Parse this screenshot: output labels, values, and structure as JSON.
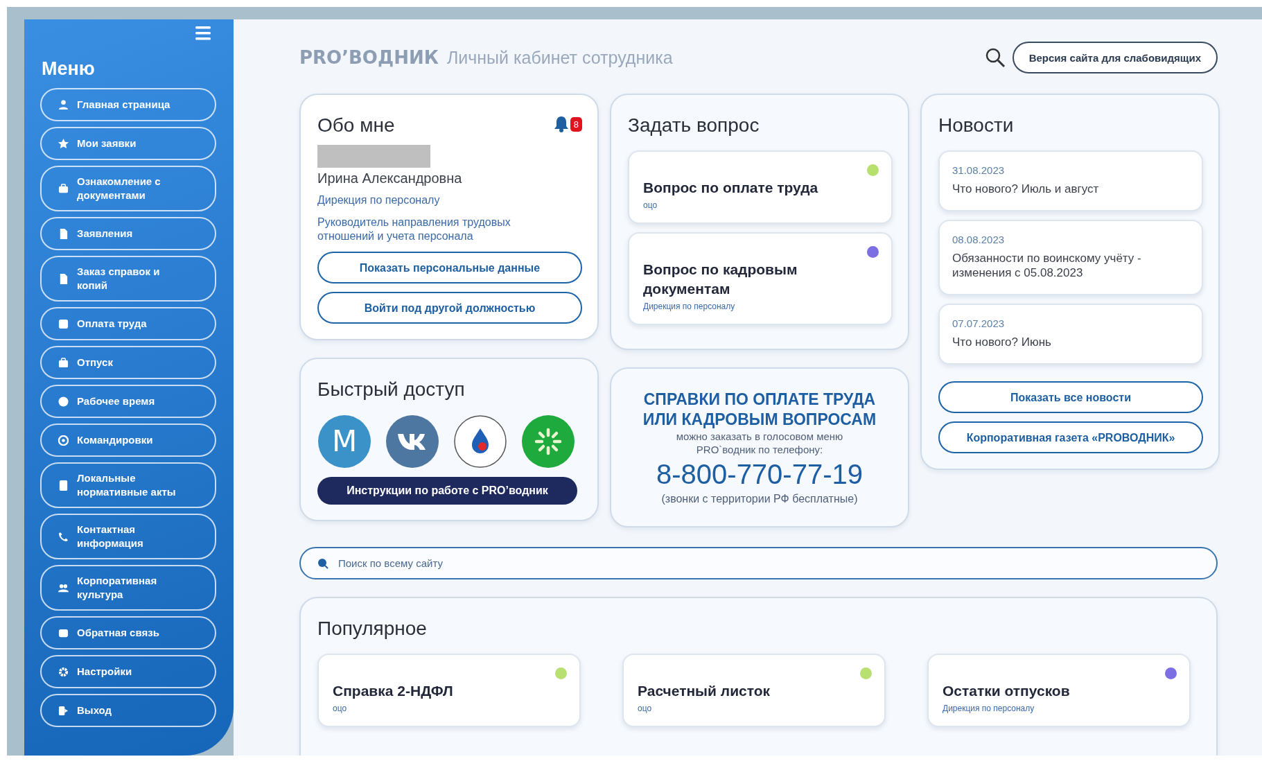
{
  "sidebar": {
    "title": "Меню",
    "items": [
      {
        "label": "Главная страница"
      },
      {
        "label": "Мои заявки"
      },
      {
        "label": "Ознакомление с документами"
      },
      {
        "label": "Заявления"
      },
      {
        "label": "Заказ справок и копий"
      },
      {
        "label": "Оплата труда"
      },
      {
        "label": "Отпуск"
      },
      {
        "label": "Рабочее время"
      },
      {
        "label": "Командировки"
      },
      {
        "label": "Локальные нормативные акты"
      },
      {
        "label": "Контактная информация"
      },
      {
        "label": "Корпоративная культура"
      },
      {
        "label": "Обратная связь"
      },
      {
        "label": "Настройки"
      },
      {
        "label": "Выход"
      }
    ]
  },
  "header": {
    "brand": "PRO’ВОДНИК",
    "subtitle": "Личный кабинет сотрудника",
    "accessibility_button": "Версия сайта для слабовидящих"
  },
  "about": {
    "title": "Обо мне",
    "notifications": "8",
    "name": "Ирина Александровна",
    "department": "Дирекция по персоналу",
    "position": "Руководитель направления трудовых отношений и учета персонала",
    "buttons": [
      "Показать персональные данные",
      "Войти под другой должностью"
    ]
  },
  "ask": {
    "title": "Задать вопрос",
    "topics": [
      {
        "title": "Вопрос по оплате труда",
        "source": "оцо",
        "color": "#b8e070"
      },
      {
        "title": "Вопрос по кадровым документам",
        "source": "Дирекция по персоналу",
        "color": "#7c6fe4"
      }
    ]
  },
  "news": {
    "title": "Новости",
    "items": [
      {
        "date": "31.08.2023",
        "title": "Что нового? Июль и август"
      },
      {
        "date": "08.08.2023",
        "title": "Обязанности по воинскому учёту - изменения с 05.08.2023"
      },
      {
        "date": "07.07.2023",
        "title": "Что нового? Июнь"
      }
    ],
    "buttons": [
      "Показать все новости",
      "Корпоративная газета «PROВОДНИК»"
    ]
  },
  "quick_access": {
    "title": "Быстрый доступ",
    "apps": [
      {
        "kind": "letter",
        "label": "M"
      },
      {
        "kind": "vk"
      },
      {
        "kind": "drop"
      },
      {
        "kind": "asterisk"
      }
    ],
    "button": "Инструкции по работе с PRO’водник"
  },
  "hotline": {
    "title": "СПРАВКИ ПО ОПЛАТЕ ТРУДА ИЛИ КАДРОВЫМ ВОПРОСАМ",
    "note": "можно заказать в голосовом меню PRO`водник по телефону:",
    "phone": "8-800-770-77-19",
    "footnote": "(звонки с территории РФ бесплатные)"
  },
  "site_search": {
    "placeholder": "Поиск по всему сайту"
  },
  "popular": {
    "title": "Популярное",
    "items": [
      {
        "title": "Справка 2-НДФЛ",
        "source": "оцо",
        "color": "#b8e070"
      },
      {
        "title": "Расчетный листок",
        "source": "оцо",
        "color": "#b8e070"
      },
      {
        "title": "Остатки отпусков",
        "source": "Дирекция по персоналу",
        "color": "#7c6fe4"
      }
    ]
  }
}
